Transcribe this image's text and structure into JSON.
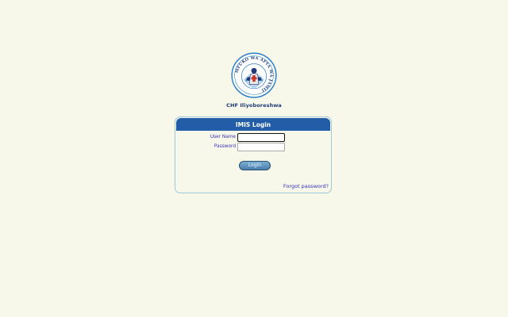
{
  "logo": {
    "icon": "chf-seal-logo",
    "ring_text": "MFUKO WA AFYA WA JAMII",
    "caption": "CHF Iliyoboreshwa"
  },
  "login": {
    "title": "IMIS Login",
    "username_label": "User Name",
    "username_value": "",
    "password_label": "Password",
    "password_value": "",
    "button_label": "Login",
    "forgot_link": "Forgot password?"
  },
  "colors": {
    "page_background": "#f7f7ea",
    "header_blue": "#235ca7",
    "label_blue": "#3333bb",
    "box_border": "#9ec7d9",
    "logo_blue": "#2a7fc4"
  }
}
